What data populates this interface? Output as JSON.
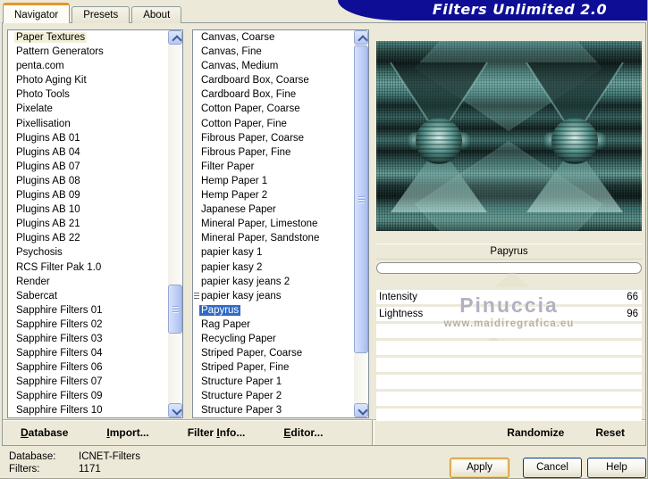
{
  "window": {
    "title": "Filters Unlimited 2.0"
  },
  "tabs": [
    {
      "label": "Navigator",
      "selected": true
    },
    {
      "label": "Presets"
    },
    {
      "label": "About"
    }
  ],
  "category_list": [
    {
      "label": "Paper Textures",
      "selected": true
    },
    {
      "label": "Pattern Generators"
    },
    {
      "label": "penta.com"
    },
    {
      "label": "Photo Aging Kit"
    },
    {
      "label": "Photo Tools"
    },
    {
      "label": "Pixelate"
    },
    {
      "label": "Pixellisation"
    },
    {
      "label": "Plugins AB 01"
    },
    {
      "label": "Plugins AB 04"
    },
    {
      "label": "Plugins AB 07"
    },
    {
      "label": "Plugins AB 08"
    },
    {
      "label": "Plugins AB 09"
    },
    {
      "label": "Plugins AB 10"
    },
    {
      "label": "Plugins AB 21"
    },
    {
      "label": "Plugins AB 22"
    },
    {
      "label": "Psychosis"
    },
    {
      "label": "RCS Filter Pak 1.0"
    },
    {
      "label": "Render"
    },
    {
      "label": "Sabercat"
    },
    {
      "label": "Sapphire Filters 01"
    },
    {
      "label": "Sapphire Filters 02"
    },
    {
      "label": "Sapphire Filters 03"
    },
    {
      "label": "Sapphire Filters 04"
    },
    {
      "label": "Sapphire Filters 06"
    },
    {
      "label": "Sapphire Filters 07"
    },
    {
      "label": "Sapphire Filters 09"
    },
    {
      "label": "Sapphire Filters 10"
    }
  ],
  "filter_list": [
    {
      "label": "Canvas, Coarse"
    },
    {
      "label": "Canvas, Fine"
    },
    {
      "label": "Canvas, Medium"
    },
    {
      "label": "Cardboard Box, Coarse"
    },
    {
      "label": "Cardboard Box, Fine"
    },
    {
      "label": "Cotton Paper, Coarse"
    },
    {
      "label": "Cotton Paper, Fine"
    },
    {
      "label": "Fibrous Paper, Coarse"
    },
    {
      "label": "Fibrous Paper, Fine"
    },
    {
      "label": "Filter Paper"
    },
    {
      "label": "Hemp Paper 1"
    },
    {
      "label": "Hemp Paper 2"
    },
    {
      "label": "Japanese Paper"
    },
    {
      "label": "Mineral Paper, Limestone"
    },
    {
      "label": "Mineral Paper, Sandstone"
    },
    {
      "label": "papier kasy 1"
    },
    {
      "label": "papier kasy 2"
    },
    {
      "label": "papier kasy jeans 2"
    },
    {
      "label": "papier kasy jeans",
      "marked": true
    },
    {
      "label": "Papyrus",
      "selected": true
    },
    {
      "label": "Rag Paper"
    },
    {
      "label": "Recycling Paper"
    },
    {
      "label": "Striped Paper, Coarse"
    },
    {
      "label": "Striped Paper, Fine"
    },
    {
      "label": "Structure Paper 1"
    },
    {
      "label": "Structure Paper 2"
    },
    {
      "label": "Structure Paper 3"
    }
  ],
  "preview": {
    "caption": "Papyrus",
    "watermark_title": "Pinuccia",
    "watermark_url": "www.maidiregrafica.eu"
  },
  "parameters": [
    {
      "label": "Intensity",
      "value": "66"
    },
    {
      "label": "Lightness",
      "value": "96"
    },
    {
      "label": "",
      "value": ""
    },
    {
      "label": "",
      "value": ""
    },
    {
      "label": "",
      "value": ""
    },
    {
      "label": "",
      "value": ""
    },
    {
      "label": "",
      "value": ""
    },
    {
      "label": "",
      "value": ""
    }
  ],
  "toolbar": {
    "database_mnemonic": "D",
    "database_rest": "atabase",
    "import_mnemonic": "I",
    "import_rest": "mport...",
    "filter_info_pre": "Filter ",
    "filter_info_mnemonic": "I",
    "filter_info_rest": "nfo...",
    "editor_mnemonic": "E",
    "editor_rest": "ditor...",
    "randomize_label": "Randomize",
    "reset_label": "Reset"
  },
  "status": {
    "database_label": "Database:",
    "database_value": "ICNET-Filters",
    "filters_label": "Filters:",
    "filters_value": "1171"
  },
  "buttons": {
    "apply": "Apply",
    "cancel": "Cancel",
    "help": "Help"
  },
  "colors": {
    "banner": "#0d0d96",
    "sel-blue": "#316ac5",
    "sel-cream": "#f3f0d8",
    "dialog-bg": "#ece9d8"
  }
}
